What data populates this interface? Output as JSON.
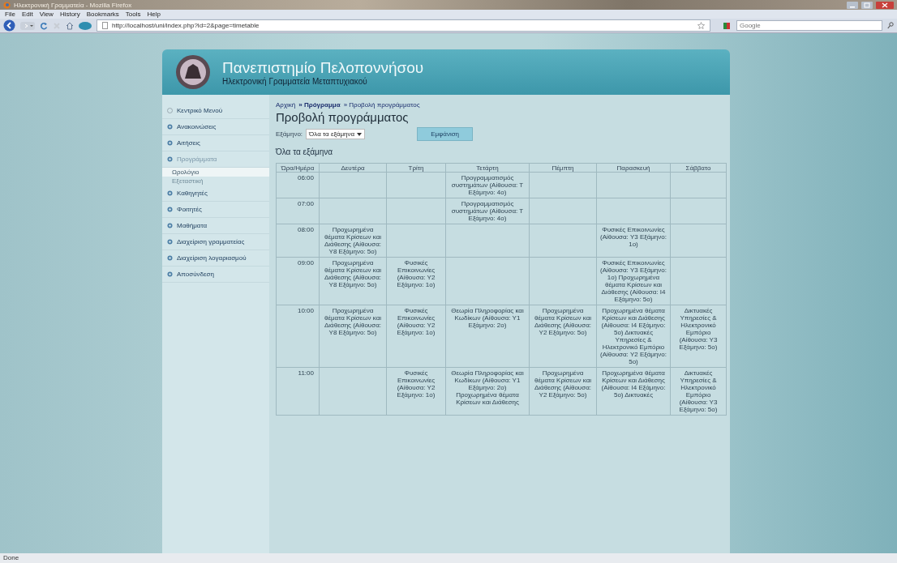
{
  "window": {
    "title": "Ηλεκτρονική Γραμματεία - Mozilla Firefox"
  },
  "menu": [
    "File",
    "Edit",
    "View",
    "History",
    "Bookmarks",
    "Tools",
    "Help"
  ],
  "address_bar": {
    "value": "http://localhost/uni/index.php?id=2&page=timetable"
  },
  "search": {
    "placeholder": "Google"
  },
  "header": {
    "title": "Πανεπιστημίο Πελοποννήσου",
    "subtitle": "Ηλεκτρονική Γραμματεία Μεταπτυχιακού"
  },
  "sidebar": {
    "items": [
      {
        "label": "Κεντρικό Μενού",
        "kind": "plain",
        "expanded": false
      },
      {
        "label": "Ανακοινώσεις",
        "kind": "bullet",
        "expanded": false
      },
      {
        "label": "Αιτήσεις",
        "kind": "bullet",
        "expanded": false
      },
      {
        "label": "Προγράμματα",
        "kind": "bullet",
        "expanded": true,
        "children": [
          {
            "label": "Ωρολόγιο",
            "selected": true
          },
          {
            "label": "Εξεταστική",
            "selected": false
          }
        ]
      },
      {
        "label": "Καθηγητές",
        "kind": "bullet",
        "expanded": false
      },
      {
        "label": "Φοιτητές",
        "kind": "bullet",
        "expanded": false
      },
      {
        "label": "Μαθήματα",
        "kind": "bullet",
        "expanded": false
      },
      {
        "label": "Διαχείριση γραμματείας",
        "kind": "bullet",
        "expanded": false
      },
      {
        "label": "Διαχείριση λογαριασμού",
        "kind": "bullet",
        "expanded": false
      },
      {
        "label": "Αποσύνδεση",
        "kind": "bullet",
        "expanded": false
      }
    ]
  },
  "breadcrumb": [
    {
      "label": "Αρχική",
      "bold": false
    },
    {
      "label": "» Πρόγραμμα",
      "bold": true
    },
    {
      "label": "» Προβολή προγράμματος",
      "bold": false
    }
  ],
  "page_title": "Προβολή προγράμματος",
  "filter": {
    "label": "Εξάμηνο:",
    "value": "Όλα τα εξάμηνα",
    "button": "Εμφάνιση"
  },
  "section_title": "Όλα τα εξάμηνα",
  "table": {
    "columns": [
      "Ώρα/Ημέρα",
      "Δευτέρα",
      "Τρίτη",
      "Τετάρτη",
      "Πέμπτη",
      "Παρασκευή",
      "Σάββατο"
    ],
    "rows": [
      [
        "06:00",
        "",
        "",
        "Προγραμματισμός συστημάτων (Αίθουσα: Τ Εξάμηνο: 4ο)",
        "",
        "",
        ""
      ],
      [
        "07:00",
        "",
        "",
        "Προγραμματισμός συστημάτων (Αίθουσα: Τ Εξάμηνο: 4ο)",
        "",
        "",
        ""
      ],
      [
        "08:00",
        "Προχωρημένα θέματα Κρίσεων και Διάθεσης (Αίθουσα: Υ8 Εξάμηνο: 5ο)",
        "",
        "",
        "",
        "Φυσικές Επικοινωνίες (Αίθουσα: Υ3 Εξάμηνο: 1ο)",
        ""
      ],
      [
        "09:00",
        "Προχωρημένα θέματα Κρίσεων και Διάθεσης (Αίθουσα: Υ8 Εξάμηνο: 5ο)",
        "Φυσικές Επικοινωνίες (Αίθουσα: Υ2 Εξάμηνο: 1ο)",
        "",
        "",
        "Φυσικές Επικοινωνίες (Αίθουσα: Υ3 Εξάμηνο: 1ο) Προχωρημένα θέματα Κρίσεων και Διάθεσης (Αίθουσα: Ι4 Εξάμηνο: 5ο)",
        ""
      ],
      [
        "10:00",
        "Προχωρημένα θέματα Κρίσεων και Διάθεσης (Αίθουσα: Υ8 Εξάμηνο: 5ο)",
        "Φυσικές Επικοινωνίες (Αίθουσα: Υ2 Εξάμηνο: 1ο)",
        "Θεωρία Πληροφορίας και Κωδίκων (Αίθουσα: Υ1 Εξάμηνο: 2ο)",
        "Προχωρημένα θέματα Κρίσεων και Διάθεσης (Αίθουσα: Υ2 Εξάμηνο: 5ο)",
        "Προχωρημένα θέματα Κρίσεων και Διάθεσης (Αίθουσα: Ι4 Εξάμηνο: 5ο) Δικτυακές Υπηρεσίες & Ηλεκτρονικό Εμπόριο (Αίθουσα: Υ2 Εξάμηνο: 5ο)",
        "Δικτυακές Υπηρεσίες & Ηλεκτρονικό Εμπόριο (Αίθουσα: Υ3 Εξάμηνο: 5ο)"
      ],
      [
        "11:00",
        "",
        "Φυσικές Επικοινωνίες (Αίθουσα: Υ2 Εξάμηνο: 1ο)",
        "Θεωρία Πληροφορίας και Κωδίκων (Αίθουσα: Υ1 Εξάμηνο: 2ο) Προχωρημένα θέματα Κρίσεων και Διάθεσης",
        "Προχωρημένα θέματα Κρίσεων και Διάθεσης (Αίθουσα: Υ2 Εξάμηνο: 5ο)",
        "Προχωρημένα θέματα Κρίσεων και Διάθεσης (Αίθουσα: Ι4 Εξάμηνο: 5ο) Δικτυακές",
        "Δικτυακές Υπηρεσίες & Ηλεκτρονικό Εμπόριο (Αίθουσα: Υ3 Εξάμηνο: 5ο)"
      ]
    ]
  },
  "status_bar": {
    "text": "Done"
  }
}
